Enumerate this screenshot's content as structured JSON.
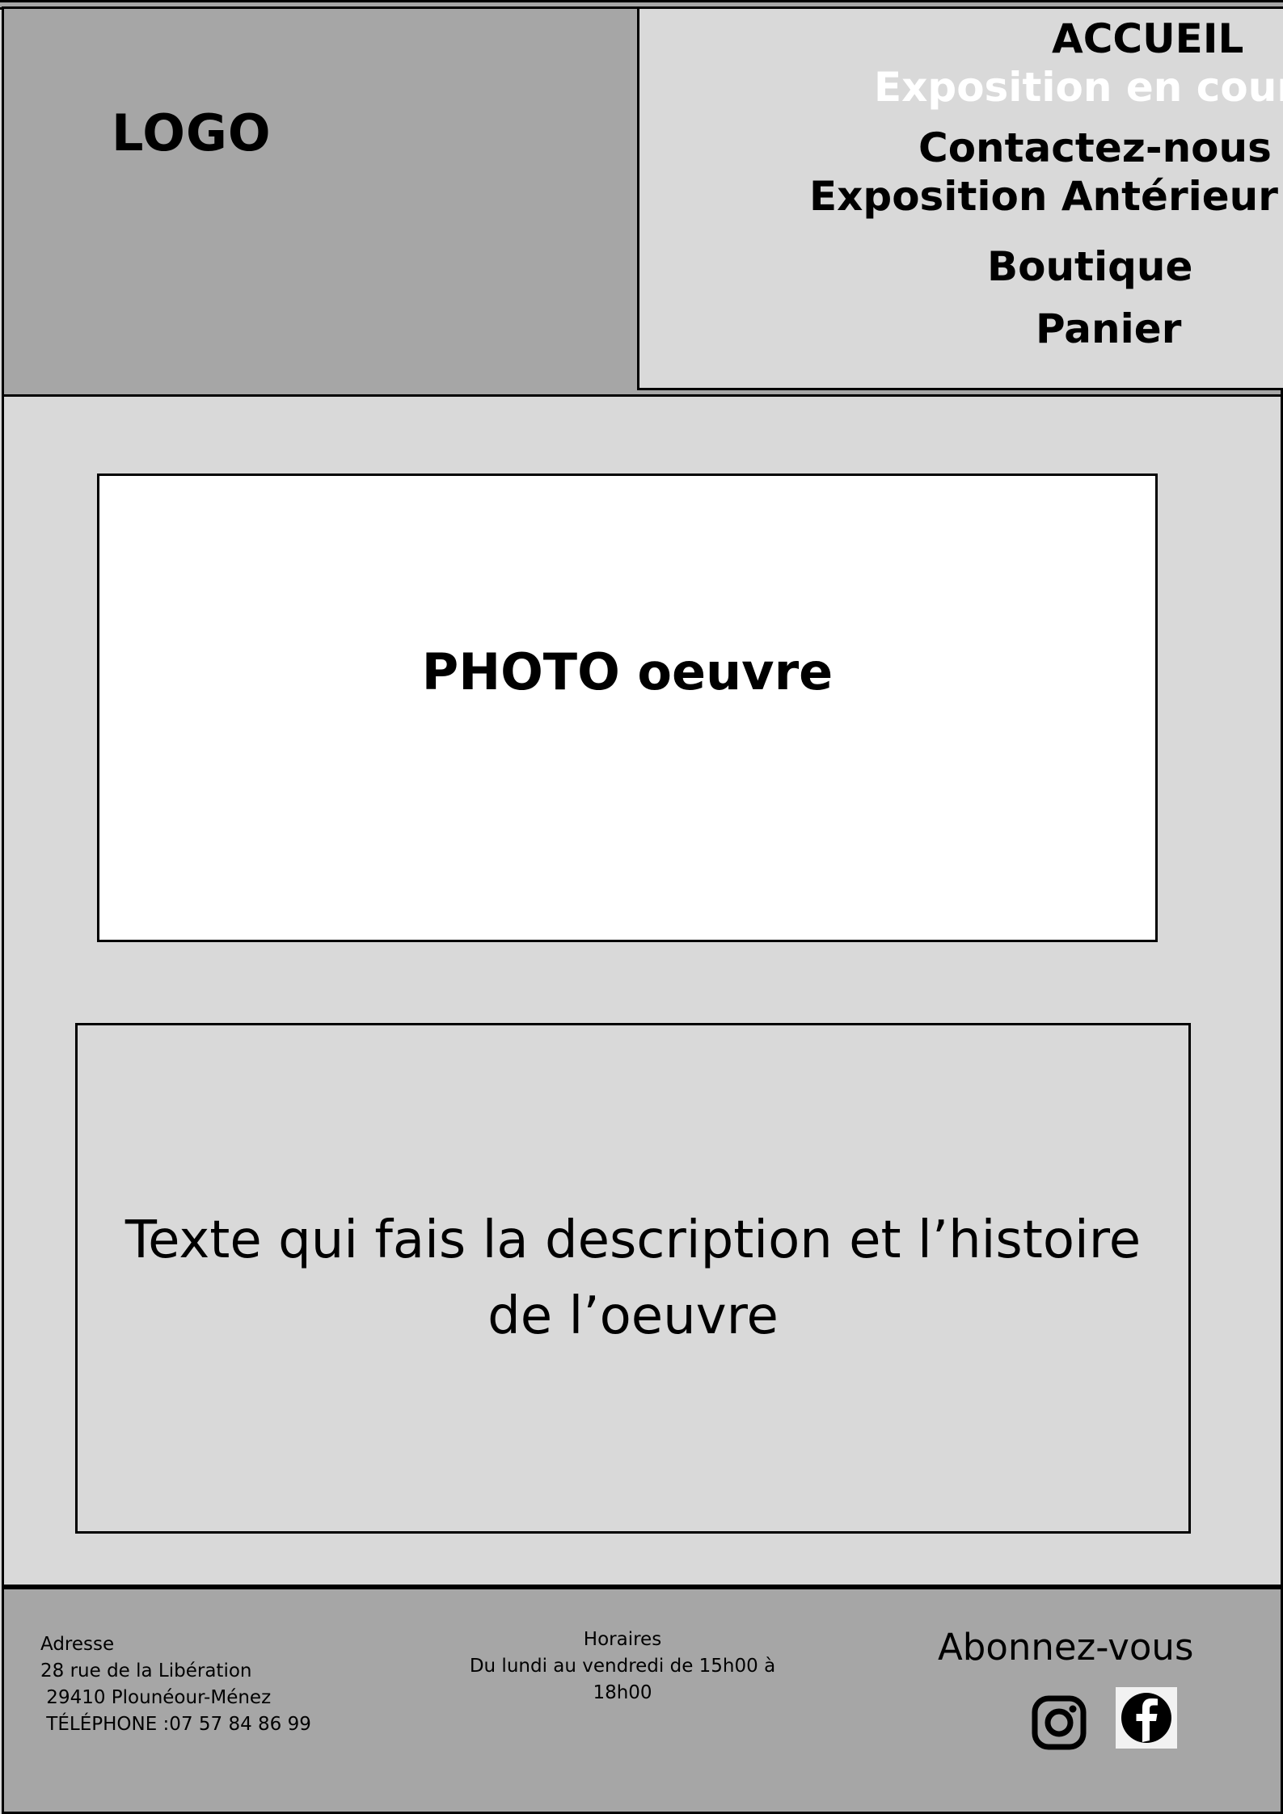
{
  "header": {
    "logo": "LOGO",
    "nav": {
      "accueil": "ACCUEIL",
      "exposition_en_cours": "Exposition en cours",
      "contactez_nous": "Contactez-nous",
      "exposition_anterieur": "Exposition Antérieur",
      "boutique": "Boutique",
      "panier": "Panier"
    },
    "active_nav_color": "#ffffff"
  },
  "main": {
    "photo_placeholder": "PHOTO oeuvre",
    "description_placeholder": "Texte qui fais la description et l’histoire de l’oeuvre"
  },
  "footer": {
    "address": {
      "title": "Adresse",
      "street": "28 rue de la Libération",
      "city": " 29410 Plounéour-Ménez",
      "phone": " TÉLÉPHONE :07 57 84 86 99"
    },
    "hours": {
      "title": "Horaires",
      "text": "Du lundi au vendredi de 15h00 à 18h00"
    },
    "subscribe": "Abonnez-vous",
    "social": [
      "instagram-icon",
      "facebook-icon"
    ]
  },
  "colors": {
    "dark_panel": "#a6a6a6",
    "light_panel": "#d9d9d9",
    "photo_bg": "#ffffff"
  }
}
